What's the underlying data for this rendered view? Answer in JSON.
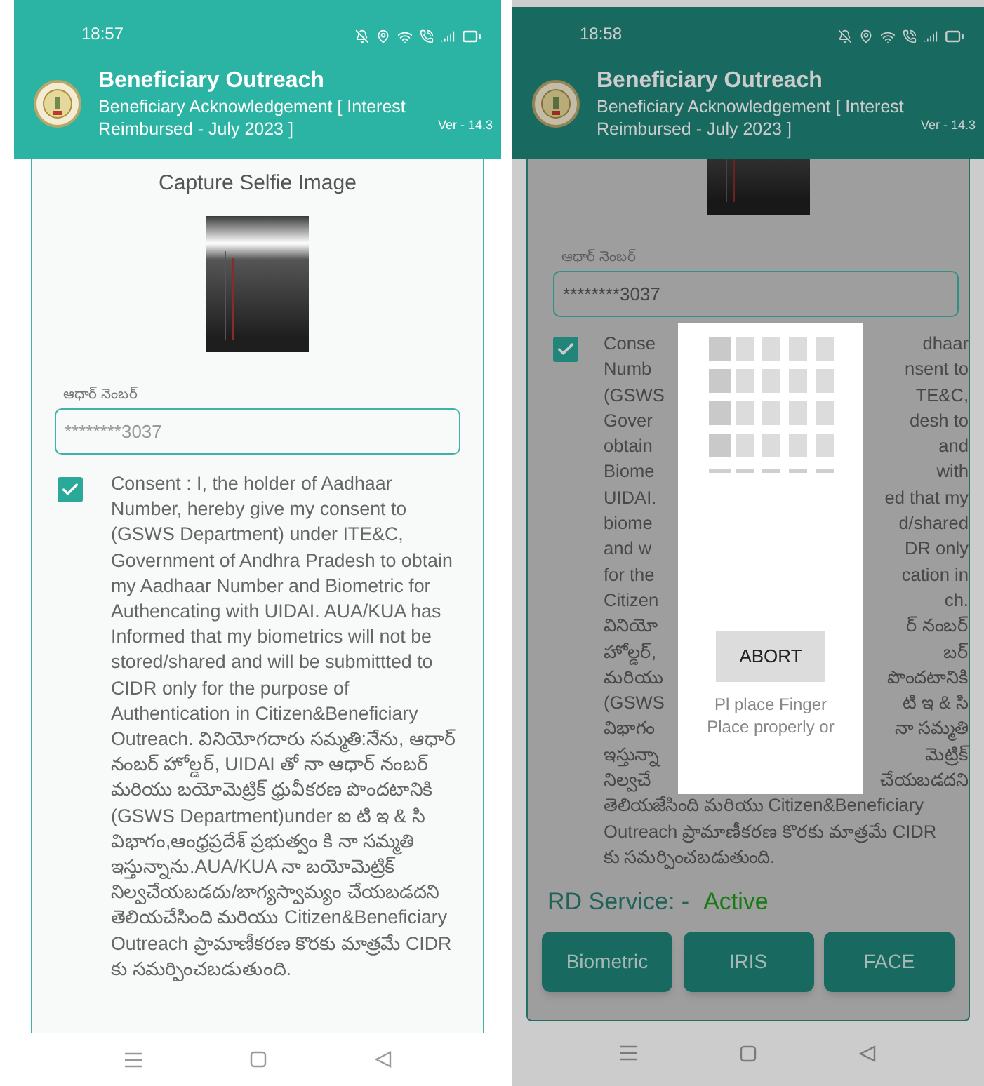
{
  "first_screen": {
    "status_bar": {
      "time": "18:57"
    },
    "header": {
      "title": "Beneficiary Outreach",
      "subtitle_lines": [
        "Beneficiary Acknowledgement [  Interest",
        "Reimbursed - July 2023 ]"
      ],
      "version": "Ver - 14.3"
    },
    "section_title": "Capture Selfie Image",
    "aadhaar_field": {
      "label": "ఆధార్ నెంబర్",
      "value": "********3037"
    },
    "consent": {
      "checked": true,
      "text": "Consent : I, the holder of Aadhaar Number, hereby give my consent to (GSWS Department) under ITE&C, Government of Andhra Pradesh to obtain my Aadhaar Number and Biometric for Authencating with UIDAI. AUA/KUA has Informed that my biometrics will not be stored/shared and will be submittted to CIDR only for the purpose of Authentication in Citizen&Beneficiary Outreach. వినియోగదారు సమ్మతి:నేను, ఆధార్ నంబర్ హోల్డర్, UIDAI తో నా ఆధార్ నంబర్ మరియు బయోమెట్రిక్ ధ్రువీకరణ పొందటానికి (GSWS Department)under ఐ టి ఇ & సి విభాగం,ఆంధ్రప్రదేశ్ ప్రభుత్వం కి నా సమ్మతి ఇస్తున్నాను.AUA/KUA నా బయోమెట్రిక్ నిల్వచేయబడదు/బాగ్యస్వామ్యం చేయబడదని తెలియచేసింది మరియు Citizen&Beneficiary Outreach ప్రామాణీకరణ కొరకు మాత్రమే CIDR కు సమర్పించబడుతుంది."
    }
  },
  "second_screen": {
    "status_bar": {
      "time": "18:58"
    },
    "header": {
      "title": "Beneficiary Outreach",
      "subtitle_lines": [
        "Beneficiary Acknowledgement [  Interest",
        "Reimbursed - July 2023 ]"
      ],
      "version": "Ver - 14.3"
    },
    "aadhaar_field": {
      "label": "ఆధార్ నెంబర్",
      "value": "********3037"
    },
    "consent": {
      "checked": true,
      "lines": [
        {
          "left": "Conse",
          "right": "dhaar"
        },
        {
          "left": "Numb",
          "right": "nsent to"
        },
        {
          "left": "(GSWS",
          "right": "TE&C,"
        },
        {
          "left": "Gover",
          "right": "desh to"
        },
        {
          "left": "obtain",
          "right": "and"
        },
        {
          "left": "Biome",
          "right": "with"
        },
        {
          "left": "UIDAI.",
          "right": "ed that my"
        },
        {
          "left": "biome",
          "right": "d/shared"
        },
        {
          "left": "and w",
          "right": "DR only"
        },
        {
          "left": "for the",
          "right": "cation in"
        },
        {
          "left": "Citizen",
          "right": "ch."
        },
        {
          "left": "వినియో",
          "right": "ర్ నంబర్"
        },
        {
          "left": "హోల్డర్,",
          "right": "బర్"
        },
        {
          "left": "మరియు",
          "right": "పొందటానికి"
        },
        {
          "left": "(GSWS",
          "right": "టి ఇ & సి"
        },
        {
          "left": "విభాగం",
          "right": "నా సమ్మతి"
        },
        {
          "left": "ఇస్తున్నా",
          "right": "మెట్రిక్"
        },
        {
          "left": "నిల్వచే",
          "right": "చేయబడదని"
        },
        {
          "left": "తెలియజేసింది మరియు Citizen&Beneficiary"
        },
        {
          "left": "Outreach ప్రామాణీకరణ కొరకు మాత్రమే CIDR"
        },
        {
          "left": "కు సమర్పించబడుతుంది."
        }
      ]
    },
    "rd_service": {
      "label": "RD Service: -",
      "status": "Active"
    },
    "buttons": [
      "Biometric",
      "IRIS",
      "FACE"
    ],
    "dialog": {
      "button": "ABORT",
      "message_lines": [
        "Pl place Finger",
        "Place properly or"
      ]
    }
  }
}
